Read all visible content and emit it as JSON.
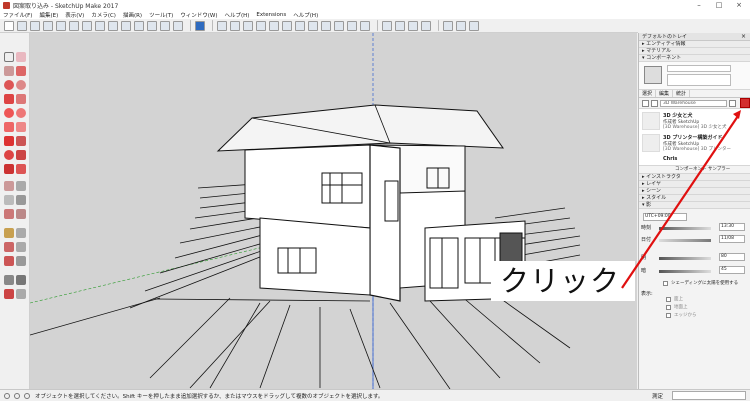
{
  "window": {
    "title": "図案取り込み - SketchUp Make 2017",
    "controls": [
      "–",
      "□",
      "×"
    ]
  },
  "menu": [
    "ファイル(F)",
    "編集(E)",
    "表示(V)",
    "カメラ(C)",
    "描画(R)",
    "ツール(T)",
    "ウィンドウ(W)",
    "ヘルプ(H)",
    "Extensions",
    "ヘルプ(H)"
  ],
  "tray": {
    "title": "デフォルトのトレイ",
    "close": "×",
    "sections_top": [
      "▸ エンティティ情報",
      "▸ マテリアル",
      "▾ コンポーネント"
    ],
    "tabs": [
      "選択",
      "編集",
      "統計"
    ],
    "search_placeholder": "3D Warehouse",
    "detail_label": "詳細",
    "results": [
      {
        "title": "3D 少女と犬",
        "author": "作成者 SketchUp",
        "desc": "[3D Warehouse] 3D 少女と犬"
      },
      {
        "title": "3D プリンター構築ガイド",
        "author": "作成者 SketchUp",
        "desc": "[3D Warehouse] 3D プリンター"
      },
      {
        "title": "Chris",
        "author": "",
        "desc": ""
      }
    ],
    "sampler_label": "コンポーネント サンプラー",
    "sections_bottom": [
      "▸ インストラクタ",
      "▸ レイヤ",
      "▸ シーン",
      "▸ スタイル",
      "▾ 影"
    ],
    "shadow": {
      "timezone": "UTC+09:00",
      "time_label": "時刻",
      "time_value": "13:30",
      "date_label": "日付",
      "date_value": "11/08",
      "light_label": "明",
      "light_value": "80",
      "dark_label": "暗",
      "dark_value": "45",
      "sun_shading": "シェーディングに太陽を使用する",
      "display_label": "表示:",
      "display_options": [
        "面上",
        "地面上",
        "エッジから"
      ]
    }
  },
  "callout": {
    "text": "クリック",
    "color": "#e01010"
  },
  "statusbar": {
    "message": "オブジェクトを選択してください。Shift キーを押したまま追加選択するか、またはマウスをドラッグして複数のオブジェクトを選択します。",
    "measure_label": "測定"
  },
  "colors": {
    "accent": "#d32f2f",
    "viewport": "#d3d3d3",
    "axis_blue": "#3060d0",
    "axis_green": "#2a9a2a"
  }
}
